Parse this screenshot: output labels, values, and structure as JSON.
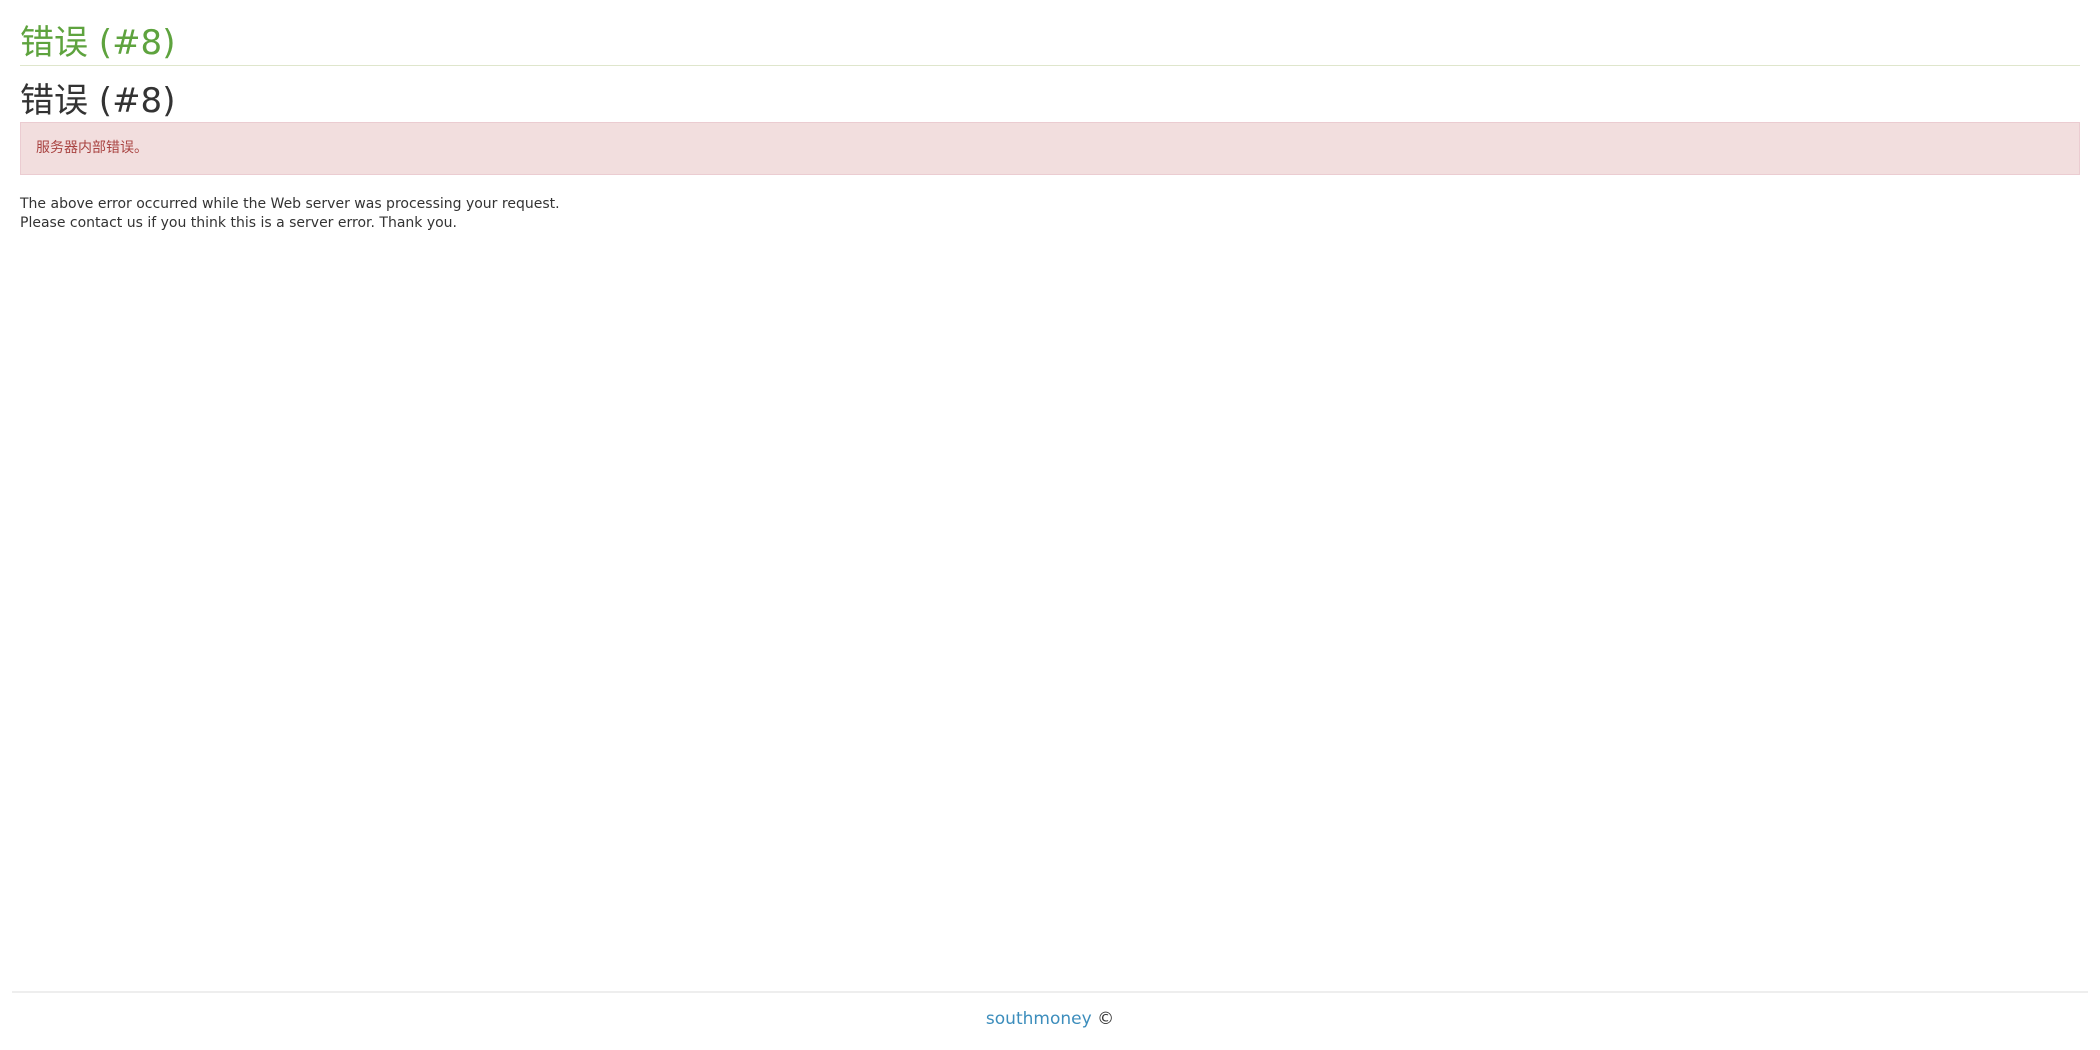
{
  "header": {
    "site_title": "错误 (#8)"
  },
  "error": {
    "title": "错误 (#8)",
    "alert_message": "服务器内部错误。",
    "explanation_line1": "The above error occurred while the Web server was processing your request.",
    "explanation_line2": "Please contact us if you think this is a server error. Thank you."
  },
  "footer": {
    "link_text": "southmoney",
    "copyright_symbol": "©"
  },
  "colors": {
    "title_green": "#5ea33e",
    "alert_background": "#f2dede",
    "alert_text": "#a94442",
    "link_blue": "#3c8dbc"
  }
}
